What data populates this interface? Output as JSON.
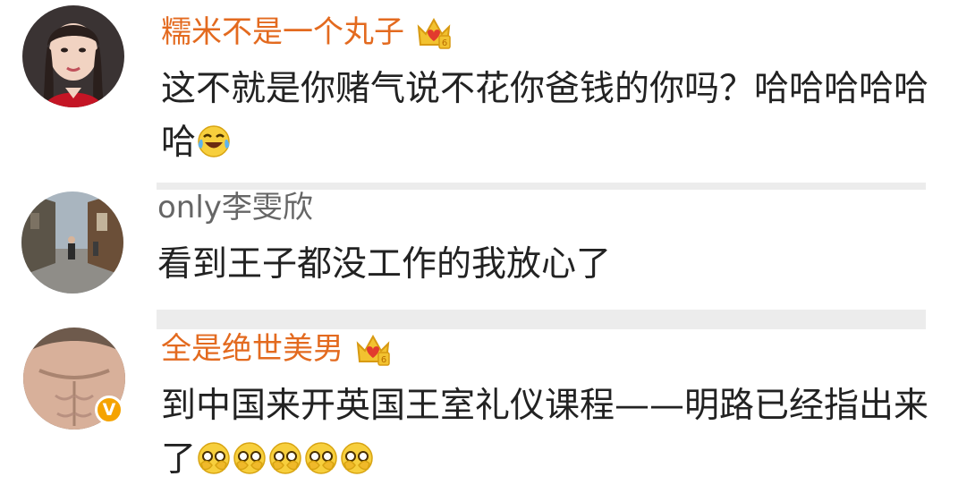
{
  "comments": [
    {
      "username": "糯米不是一个丸子",
      "vip": true,
      "text": "这不就是你赌气说不花你爸钱的你吗？哈哈哈哈哈哈",
      "emojis": [
        "laugh-cry-emoji"
      ],
      "verified": false
    },
    {
      "username": "only李雯欣",
      "vip": false,
      "text": "看到王子都没工作的我放心了",
      "emojis": [],
      "verified": false
    },
    {
      "username": "全是绝世美男",
      "vip": true,
      "text": "到中国来开英国王室礼仪课程——明路已经指出来了",
      "emojis": [
        "peek-emoji",
        "peek-emoji",
        "peek-emoji",
        "peek-emoji",
        "peek-emoji"
      ],
      "verified": true,
      "verified_badge": "V"
    }
  ],
  "colors": {
    "vip_name": "#e36a1f",
    "plain_name": "#666666",
    "text": "#222222",
    "divider": "#ececec",
    "verified_badge": "#f5a300"
  },
  "icons": {
    "vip_badge": "crown-icon",
    "verified_badge": "verified-badge-icon"
  }
}
